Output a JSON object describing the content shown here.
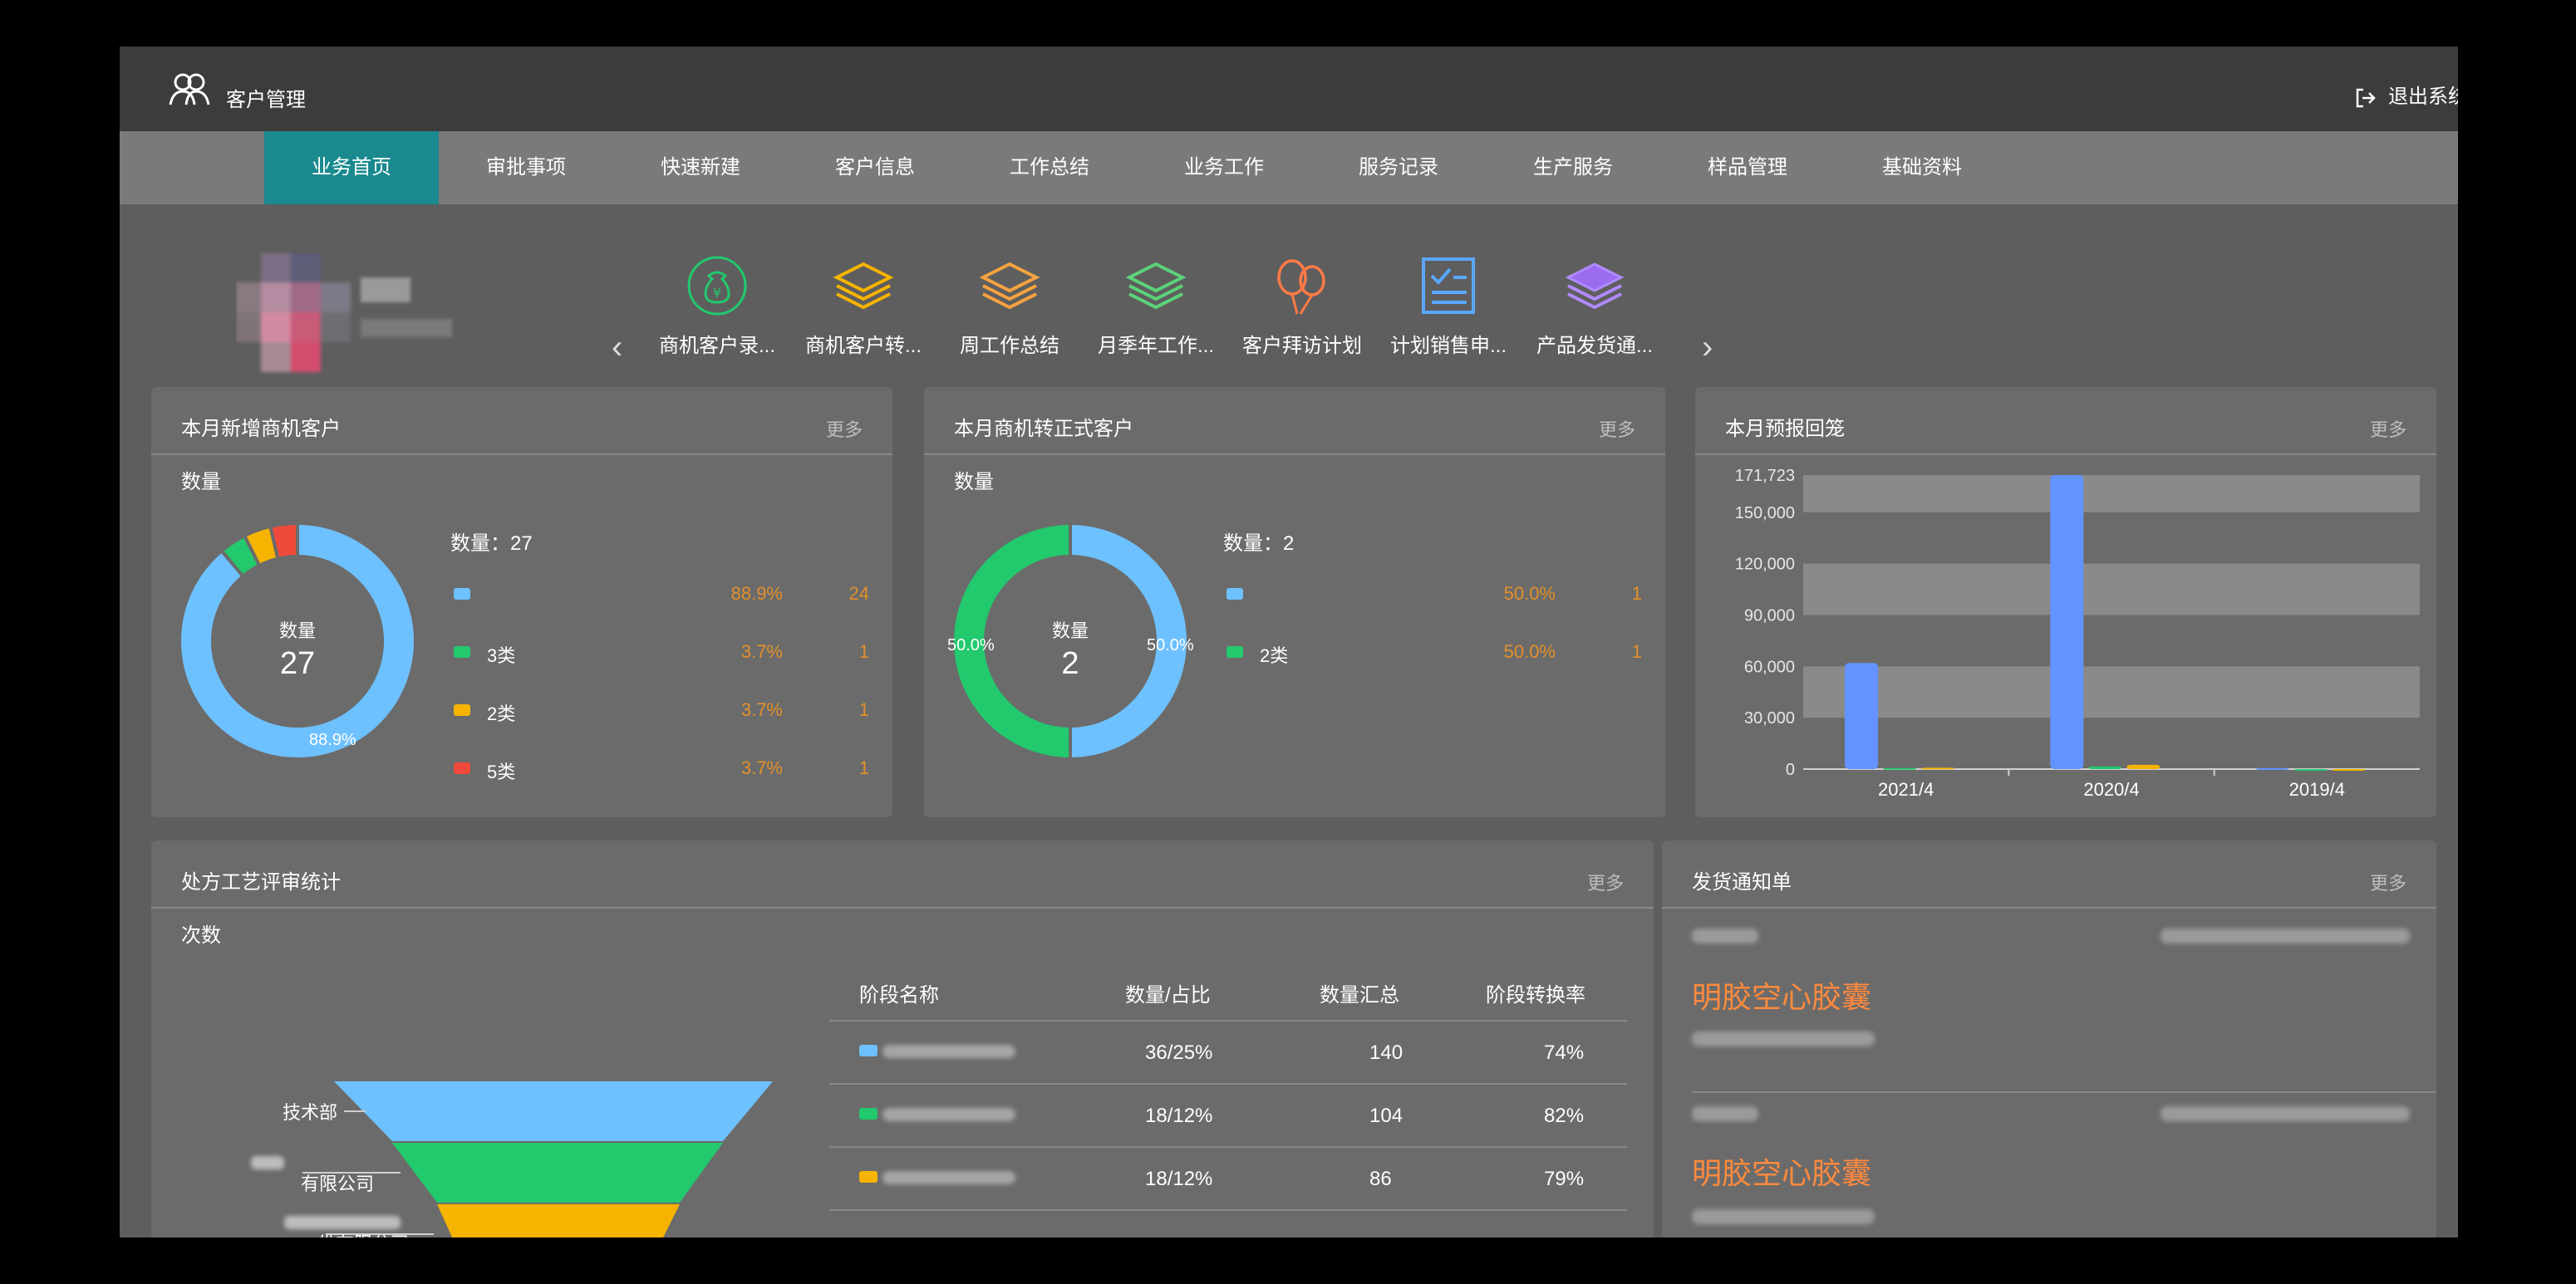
{
  "app": {
    "title": "客户管理",
    "logout_label": "退出系统"
  },
  "colors": {
    "accent": "#1a8a8f",
    "blue": "#6ec1ff",
    "green": "#22c96d",
    "yellow": "#f6b400",
    "red": "#ef4a3b",
    "orange": "#ff8a3d"
  },
  "nav": [
    "业务首页",
    "审批事项",
    "快速新建",
    "客户信息",
    "工作总结",
    "业务工作",
    "服务记录",
    "生产服务",
    "样品管理",
    "基础资料"
  ],
  "shortcuts": [
    {
      "label": "商机客户录...",
      "icon": "money-bag-icon"
    },
    {
      "label": "商机客户转...",
      "icon": "layers-icon"
    },
    {
      "label": "周工作总结",
      "icon": "layers-icon"
    },
    {
      "label": "月季年工作...",
      "icon": "layers-icon"
    },
    {
      "label": "客户拜访计划",
      "icon": "balloons-icon"
    },
    {
      "label": "计划销售申...",
      "icon": "checklist-icon"
    },
    {
      "label": "产品发货通...",
      "icon": "layers-icon"
    }
  ],
  "panel1": {
    "title": "本月新增商机客户",
    "more": "更多",
    "unit": "数量",
    "legend_title": "数量：27",
    "center_label": "数量",
    "center_value": "27",
    "slice_label": "88.9%",
    "rows": [
      {
        "name": "",
        "pct": "88.9%",
        "count": "24",
        "value": 24,
        "color": "#6ec1ff"
      },
      {
        "name": "3类",
        "pct": "3.7%",
        "count": "1",
        "value": 1,
        "color": "#22c96d"
      },
      {
        "name": "2类",
        "pct": "3.7%",
        "count": "1",
        "value": 1,
        "color": "#f6b400"
      },
      {
        "name": "5类",
        "pct": "3.7%",
        "count": "1",
        "value": 1,
        "color": "#ef4a3b"
      }
    ]
  },
  "panel2": {
    "title": "本月商机转正式客户",
    "more": "更多",
    "unit": "数量",
    "legend_title": "数量：2",
    "center_label": "数量",
    "center_value": "2",
    "label_left": "50.0%",
    "label_right": "50.0%",
    "rows": [
      {
        "name": "",
        "pct": "50.0%",
        "count": "1",
        "value": 1,
        "color": "#6ec1ff"
      },
      {
        "name": "2类",
        "pct": "50.0%",
        "count": "1",
        "value": 1,
        "color": "#22c96d"
      }
    ]
  },
  "panel3": {
    "title": "本月预报回笼",
    "more": "更多"
  },
  "chart_data": {
    "type": "bar",
    "categories": [
      "2021/4",
      "2020/4",
      "2019/4"
    ],
    "series": [
      {
        "values": [
          62000,
          171723,
          500
        ],
        "color": "#6393ff"
      },
      {
        "values": [
          600,
          1500,
          0
        ],
        "color": "#22c96d"
      },
      {
        "values": [
          800,
          2500,
          0
        ],
        "color": "#f6b400"
      }
    ],
    "yticks": [
      "171,723",
      "150,000",
      "120,000",
      "90,000",
      "60,000",
      "30,000",
      "0"
    ],
    "ytick_values": [
      171723,
      150000,
      120000,
      90000,
      60000,
      30000,
      0
    ],
    "ylim": [
      0,
      171723
    ],
    "grid": true
  },
  "panel4": {
    "title": "处方工艺评审统计",
    "more": "更多",
    "unit": "次数",
    "funnel_labels": [
      "技术部",
      "有限公司",
      "份有限公司"
    ],
    "headers": [
      "阶段名称",
      "数量/占比",
      "数量汇总",
      "阶段转换率"
    ],
    "rows": [
      {
        "ratio": "36/25%",
        "total": "140",
        "rate": "74%",
        "color": "#6ec1ff"
      },
      {
        "ratio": "18/12%",
        "total": "104",
        "rate": "82%",
        "color": "#22c96d"
      },
      {
        "ratio": "18/12%",
        "total": "86",
        "rate": "79%",
        "color": "#f6b400"
      }
    ]
  },
  "panel5": {
    "title": "发货通知单",
    "more": "更多",
    "items": [
      {
        "product": "明胶空心胶囊"
      },
      {
        "product": "明胶空心胶囊"
      }
    ]
  }
}
